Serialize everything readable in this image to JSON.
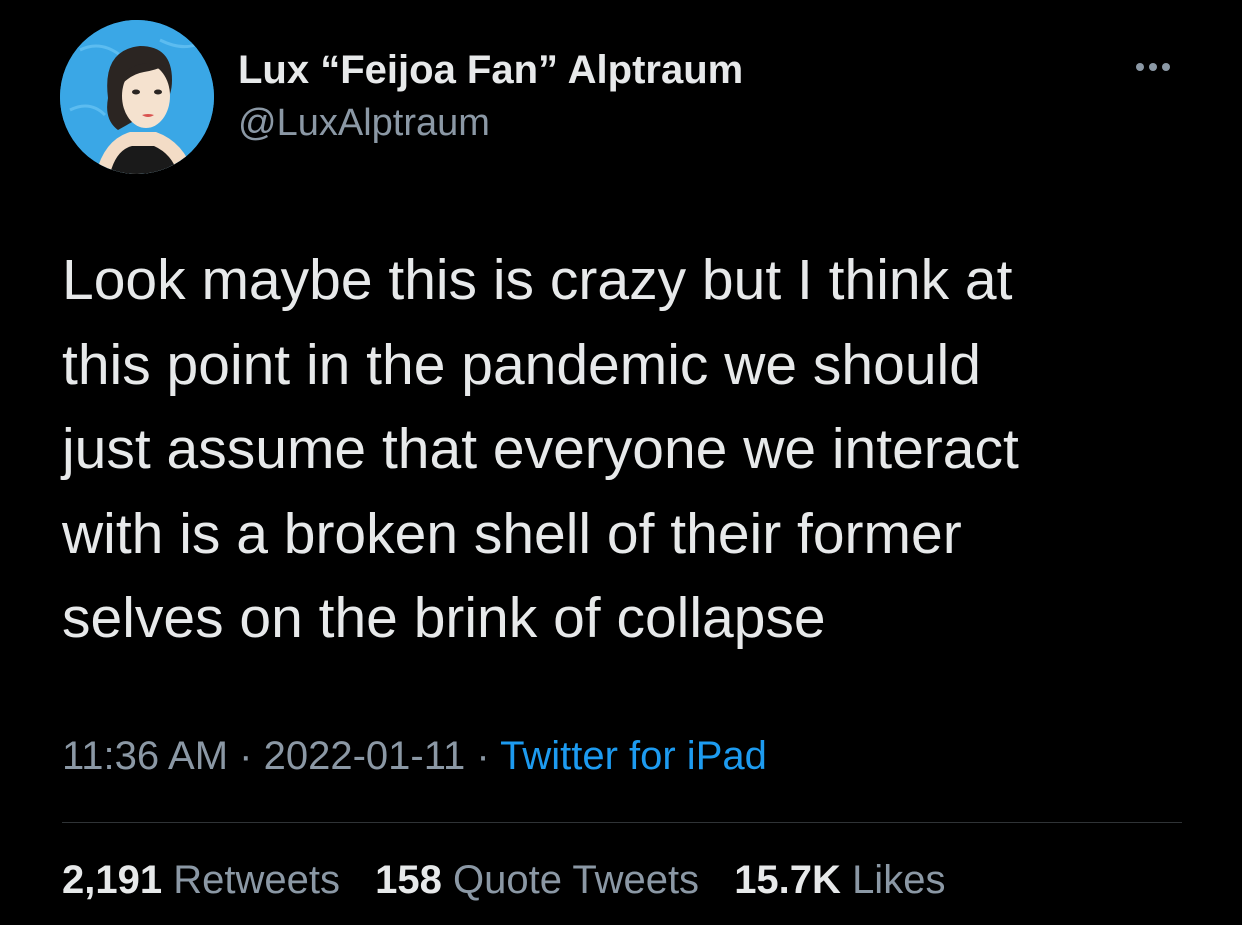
{
  "author": {
    "display_name": "Lux “Feijoa Fan” Alptraum",
    "handle": "@LuxAlptraum"
  },
  "tweet": {
    "text": "Look maybe this is crazy but I think at\nthis point in the pandemic we should\njust assume that everyone we interact\nwith is a broken shell of their former\nselves on the brink of collapse",
    "time": "11:36 AM",
    "separator": "·",
    "date": "2022-01-11",
    "source": "Twitter for iPad"
  },
  "stats": {
    "retweets_count": "2,191",
    "retweets_label": "Retweets",
    "quote_count": "158",
    "quote_label": "Quote Tweets",
    "likes_count": "15.7K",
    "likes_label": "Likes"
  },
  "icons": {
    "more": "more-horizontal-icon"
  },
  "colors": {
    "background": "#000000",
    "primary_text": "#e7e9ea",
    "secondary_text": "#8b98a5",
    "link": "#1d9bf0",
    "divider": "#2f3336",
    "avatar_bg": "#3aa7e6"
  }
}
